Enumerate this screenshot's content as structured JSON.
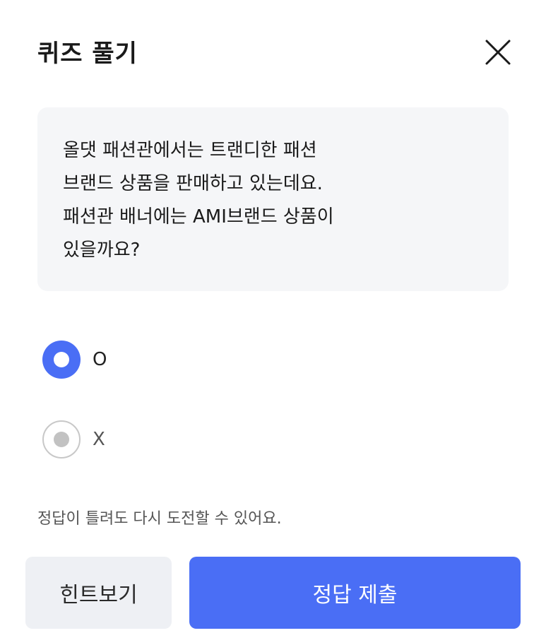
{
  "header": {
    "title": "퀴즈 풀기",
    "close_icon": "close-icon"
  },
  "question": {
    "lines": [
      "올댓 패션관에서는 트랜디한 패션",
      "브랜드 상품을 판매하고 있는데요.",
      "패션관 배너에는 AMI브랜드 상품이",
      "있을까요?"
    ]
  },
  "options": [
    {
      "label": "O",
      "selected": true
    },
    {
      "label": "X",
      "selected": false
    }
  ],
  "notice": "정답이 틀려도 다시 도전할 수 있어요.",
  "buttons": {
    "hint_label": "힌트보기",
    "submit_label": "정답 제출"
  },
  "colors": {
    "accent": "#4a6ef5",
    "question_bg": "#f5f6f8",
    "hint_bg": "#eef0f4"
  }
}
